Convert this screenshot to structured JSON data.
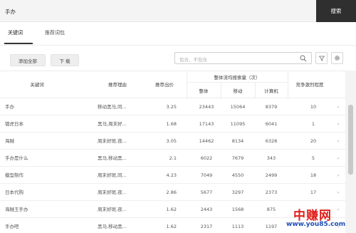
{
  "search": {
    "query": "手办",
    "button_label": "搜索"
  },
  "tabs": [
    {
      "label": "关键词",
      "active": true
    },
    {
      "label": "推荐词包",
      "active": false
    }
  ],
  "toolbar": {
    "add_all_label": "添加全部",
    "download_label": "下 载",
    "filter_placeholder": "包含、不包含",
    "search_icon": "search-icon",
    "filter_icon": "funnel-icon",
    "settings_icon": "gear-icon"
  },
  "table": {
    "headers": {
      "keyword": "关键词",
      "reason": "推荐理由",
      "price": "推荐出价",
      "search_group": "整体流均搜索量（次）",
      "total": "整体",
      "mobile": "移动",
      "pc": "计算机",
      "competition": "竞争激烈程度"
    },
    "rows": [
      {
        "keyword": "手办",
        "reason": "移动黑马,同...",
        "price": "3.25",
        "total": "23443",
        "mobile": "15064",
        "pc": "8379",
        "competition": "10"
      },
      {
        "keyword": "镀虎日本",
        "reason": "黑马,周末好...",
        "price": "1.68",
        "total": "17143",
        "mobile": "11095",
        "pc": "6041",
        "competition": "1"
      },
      {
        "keyword": "海贼",
        "reason": "周末好斑,夜...",
        "price": "3.05",
        "total": "14462",
        "mobile": "8134",
        "pc": "6328",
        "competition": "20"
      },
      {
        "keyword": "手办是什么",
        "reason": "黑马,移动黑...",
        "price": "2.1",
        "total": "6022",
        "mobile": "7679",
        "pc": "343",
        "competition": "5"
      },
      {
        "keyword": "模型制作",
        "reason": "周末好斑,同...",
        "price": "4.23",
        "total": "7049",
        "mobile": "4550",
        "pc": "2499",
        "competition": "18"
      },
      {
        "keyword": "日本代购",
        "reason": "周末好斑,夜...",
        "price": "2.86",
        "total": "5677",
        "mobile": "3297",
        "pc": "2373",
        "competition": "17"
      },
      {
        "keyword": "海贼王手办",
        "reason": "周末好斑,夜...",
        "price": "1.62",
        "total": "2443",
        "mobile": "1568",
        "pc": "875",
        "competition": ""
      },
      {
        "keyword": "手办吧",
        "reason": "黑马,移动黑...",
        "price": "1.62",
        "total": "2317",
        "mobile": "1113",
        "pc": "1197",
        "competition": ""
      }
    ],
    "row_arrow": "›"
  },
  "watermark": {
    "main": "中赚网",
    "url": "www.you85.com"
  }
}
